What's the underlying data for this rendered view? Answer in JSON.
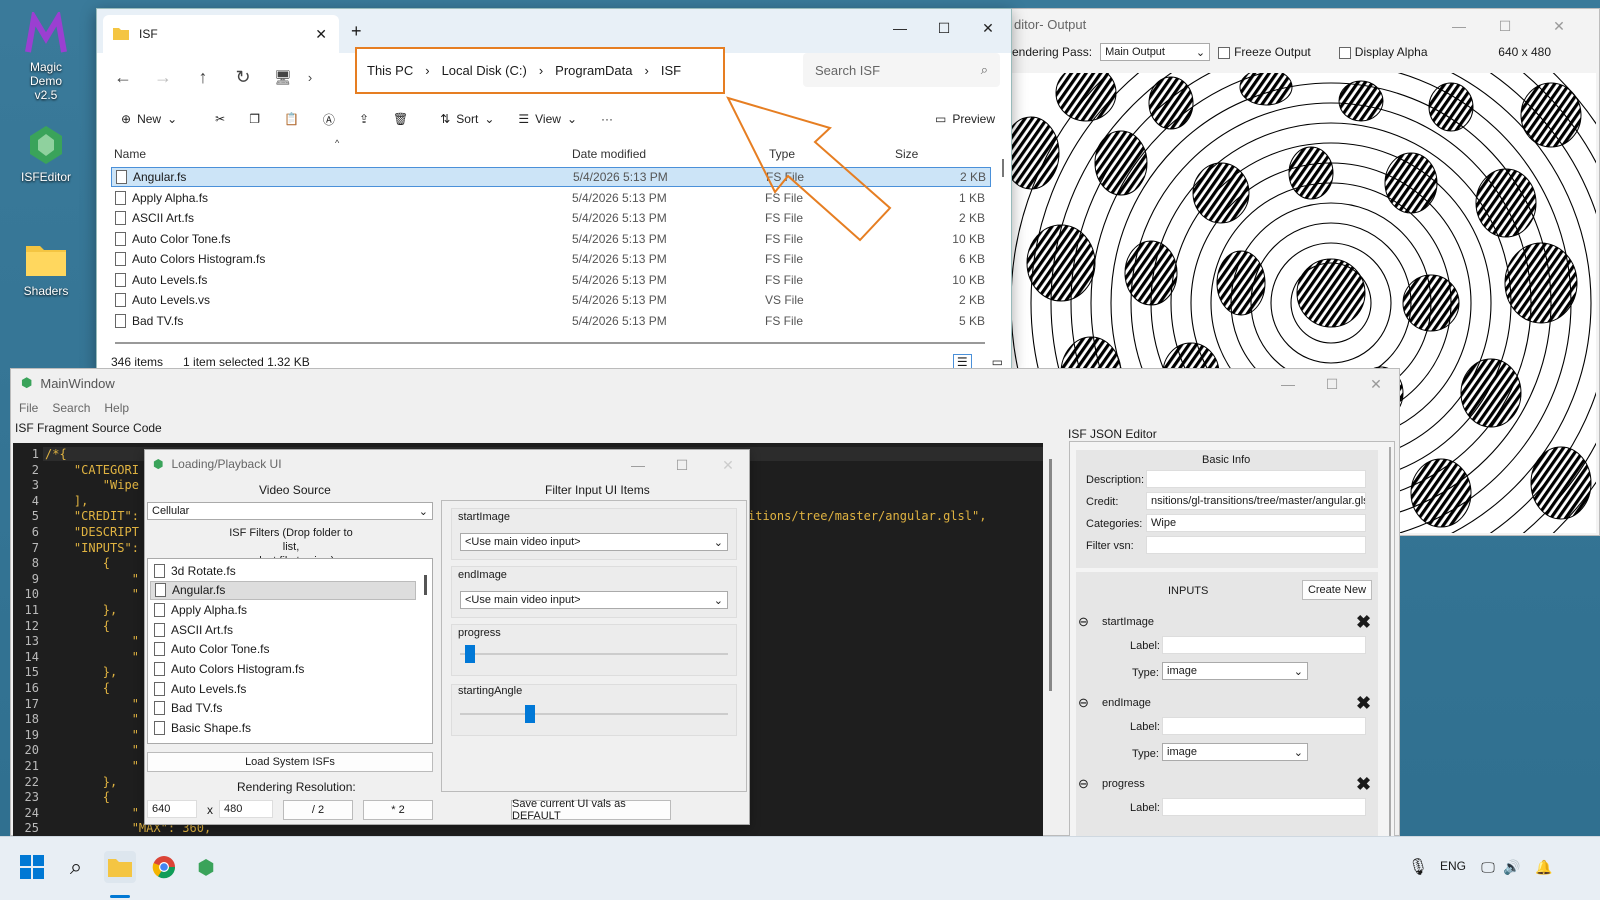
{
  "desktop": {
    "icons": [
      {
        "label_line1": "Magic Demo",
        "label_line2": "v2.5",
        "icon": "magic-m-icon"
      },
      {
        "label": "ISFEditor",
        "icon": "isf-editor-icon"
      },
      {
        "label": "Shaders",
        "icon": "folder-icon"
      }
    ]
  },
  "output_window": {
    "title": "ditor- Output",
    "rendering_pass_label": "endering Pass:",
    "rendering_pass_value": "Main Output",
    "freeze_label": "Freeze Output",
    "alpha_label": "Display Alpha",
    "resolution": "640 x 480"
  },
  "explorer": {
    "tab_title": "ISF",
    "breadcrumbs": [
      "This PC",
      "Local Disk (C:)",
      "ProgramData",
      "ISF"
    ],
    "search_placeholder": "Search ISF",
    "toolbar": {
      "new": "New",
      "sort": "Sort",
      "view": "View",
      "more": "···",
      "preview": "Preview"
    },
    "columns": [
      "Name",
      "Date modified",
      "Type",
      "Size"
    ],
    "files": [
      {
        "name": "Angular.fs",
        "date": "5/4/2026 5:13 PM",
        "type": "FS File",
        "size": "2 KB"
      },
      {
        "name": "Apply Alpha.fs",
        "date": "5/4/2026 5:13 PM",
        "type": "FS File",
        "size": "1 KB"
      },
      {
        "name": "ASCII Art.fs",
        "date": "5/4/2026 5:13 PM",
        "type": "FS File",
        "size": "2 KB"
      },
      {
        "name": "Auto Color Tone.fs",
        "date": "5/4/2026 5:13 PM",
        "type": "FS File",
        "size": "10 KB"
      },
      {
        "name": "Auto Colors Histogram.fs",
        "date": "5/4/2026 5:13 PM",
        "type": "FS File",
        "size": "6 KB"
      },
      {
        "name": "Auto Levels.fs",
        "date": "5/4/2026 5:13 PM",
        "type": "FS File",
        "size": "10 KB"
      },
      {
        "name": "Auto Levels.vs",
        "date": "5/4/2026 5:13 PM",
        "type": "VS File",
        "size": "2 KB"
      },
      {
        "name": "Bad TV.fs",
        "date": "5/4/2026 5:13 PM",
        "type": "FS File",
        "size": "5 KB"
      }
    ],
    "status_count": "346 items",
    "status_selected": "1 item selected  1.32 KB"
  },
  "main_window": {
    "title": "MainWindow",
    "menu": [
      "File",
      "Search",
      "Help"
    ],
    "code_label": "ISF Fragment Source Code",
    "json_label": "ISF JSON Editor",
    "code_lines": [
      {
        "n": "1",
        "t": "/*{"
      },
      {
        "n": "2",
        "t": "    \"CATEGORI"
      },
      {
        "n": "3",
        "t": "        \"Wipe"
      },
      {
        "n": "4",
        "t": "    ],"
      },
      {
        "n": "5",
        "t": "    \"CREDIT\":"
      },
      {
        "n": "6",
        "t": "    \"DESCRIPT"
      },
      {
        "n": "7",
        "t": "    \"INPUTS\":"
      },
      {
        "n": "8",
        "t": "        {"
      },
      {
        "n": "9",
        "t": "            \""
      },
      {
        "n": "10",
        "t": "            \""
      },
      {
        "n": "11",
        "t": "        },"
      },
      {
        "n": "12",
        "t": "        {"
      },
      {
        "n": "13",
        "t": "            \""
      },
      {
        "n": "14",
        "t": "            \""
      },
      {
        "n": "15",
        "t": "        },"
      },
      {
        "n": "16",
        "t": "        {"
      },
      {
        "n": "17",
        "t": "            \""
      },
      {
        "n": "18",
        "t": "            \""
      },
      {
        "n": "19",
        "t": "            \""
      },
      {
        "n": "20",
        "t": "            \""
      },
      {
        "n": "21",
        "t": "            \""
      },
      {
        "n": "22",
        "t": "        },"
      },
      {
        "n": "23",
        "t": "        {"
      },
      {
        "n": "24",
        "t": "            \""
      },
      {
        "n": "25",
        "t": "            \"MAX\": 360,"
      }
    ],
    "code_fragment_right": "itions/tree/master/angular.glsl\",",
    "json_editor": {
      "basic_info": "Basic Info",
      "description_label": "Description:",
      "description_value": "",
      "credit_label": "Credit:",
      "credit_value": "nsitions/gl-transitions/tree/master/angular.glsl",
      "categories_label": "Categories:",
      "categories_value": "Wipe",
      "filter_vsn_label": "Filter vsn:",
      "filter_vsn_value": "",
      "inputs_label": "INPUTS",
      "create_new": "Create New",
      "inputs": [
        {
          "name": "startImage",
          "label_label": "Label:",
          "type_label": "Type:",
          "type_value": "image"
        },
        {
          "name": "endImage",
          "label_label": "Label:",
          "type_label": "Type:",
          "type_value": "image"
        },
        {
          "name": "progress",
          "label_label": "Label:"
        }
      ]
    }
  },
  "loading_window": {
    "title": "Loading/Playback UI",
    "video_source_label": "Video Source",
    "video_source_value": "Cellular",
    "filters_label_1": "ISF Filters (Drop folder to list,",
    "filters_label_2": "select file to view)",
    "filters": [
      "3d Rotate.fs",
      "Angular.fs",
      "Apply Alpha.fs",
      "ASCII Art.fs",
      "Auto Color Tone.fs",
      "Auto Colors Histogram.fs",
      "Auto Levels.fs",
      "Bad TV.fs",
      "Basic Shape.fs"
    ],
    "load_system": "Load System ISFs",
    "rendering_res_label": "Rendering Resolution:",
    "width": "640",
    "x": "x",
    "height": "480",
    "half": "/ 2",
    "double": "* 2",
    "filter_items_label": "Filter Input UI Items",
    "start_image_label": "startImage",
    "start_image_value": "<Use main video input>",
    "end_image_label": "endImage",
    "end_image_value": "<Use main video input>",
    "progress_label": "progress",
    "progress_value": 0.02,
    "angle_label": "startingAngle",
    "angle_value": 0.25,
    "save_default": "Save current UI vals as DEFAULT"
  },
  "taskbar": {
    "lang": "ENG"
  },
  "colors": {
    "accent": "#e67e22",
    "selection": "#cce4f7",
    "slider": "#0078d7",
    "code_text": "#e0b341"
  }
}
